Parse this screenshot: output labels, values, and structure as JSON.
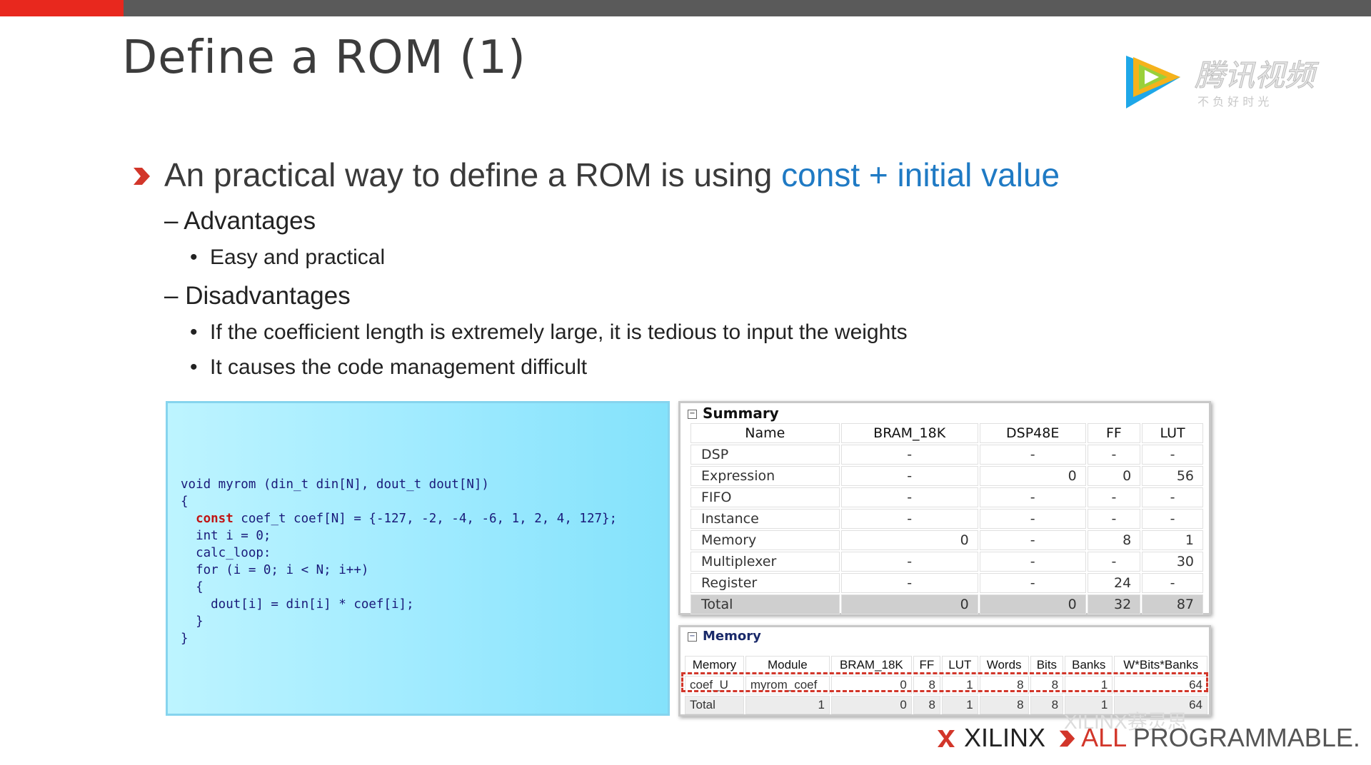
{
  "slide": {
    "title": "Define a ROM (1)",
    "bullet_main_prefix": "An practical way to define a ROM is using ",
    "bullet_main_highlight": "const + initial value",
    "advantages_label": "– Advantages",
    "advantages_items": [
      "Easy and practical"
    ],
    "disadvantages_label": "– Disadvantages",
    "disadvantages_items": [
      "If the coefficient length is extremely large, it is tedious to input the weights",
      "It causes the code management difficult"
    ]
  },
  "code": {
    "lines": [
      "void myrom (din_t din[N], dout_t dout[N])",
      "{",
      "  const coef_t coef[N] = {-127, -2, -4, -6, 1, 2, 4, 127};",
      "  int i = 0;",
      "  calc_loop:",
      "  for (i = 0; i < N; i++)",
      "  {",
      "    dout[i] = din[i] * coef[i];",
      "  }",
      "}"
    ],
    "keyword": "const"
  },
  "summary": {
    "title": "Summary",
    "columns": [
      "Name",
      "BRAM_18K",
      "DSP48E",
      "FF",
      "LUT"
    ],
    "rows": [
      [
        "DSP",
        "-",
        "-",
        "-",
        "-"
      ],
      [
        "Expression",
        "-",
        "0",
        "0",
        "56"
      ],
      [
        "FIFO",
        "-",
        "-",
        "-",
        "-"
      ],
      [
        "Instance",
        "-",
        "-",
        "-",
        "-"
      ],
      [
        "Memory",
        "0",
        "-",
        "8",
        "1"
      ],
      [
        "Multiplexer",
        "-",
        "-",
        "-",
        "30"
      ],
      [
        "Register",
        "-",
        "-",
        "24",
        "-"
      ],
      [
        "Total",
        "0",
        "0",
        "32",
        "87"
      ]
    ]
  },
  "memory": {
    "title": "Memory",
    "columns": [
      "Memory",
      "Module",
      "BRAM_18K",
      "FF",
      "LUT",
      "Words",
      "Bits",
      "Banks",
      "W*Bits*Banks"
    ],
    "rows": [
      [
        "coef_U",
        "myrom_coef",
        "0",
        "8",
        "1",
        "8",
        "8",
        "1",
        "64"
      ],
      [
        "Total",
        "1",
        "0",
        "8",
        "1",
        "8",
        "8",
        "1",
        "64"
      ]
    ]
  },
  "branding": {
    "tencent_logo_text": "腾讯视频",
    "tencent_slogan": "不 负 好 时 光",
    "xilinx": "XILINX",
    "all": "ALL",
    "programmable": " PROGRAMMABLE.",
    "watermark": "XILINX赛灵思"
  },
  "colors": {
    "highlight": "#1f7ac4",
    "accent_red": "#e8281e",
    "code_bg": "#a6ecff"
  }
}
